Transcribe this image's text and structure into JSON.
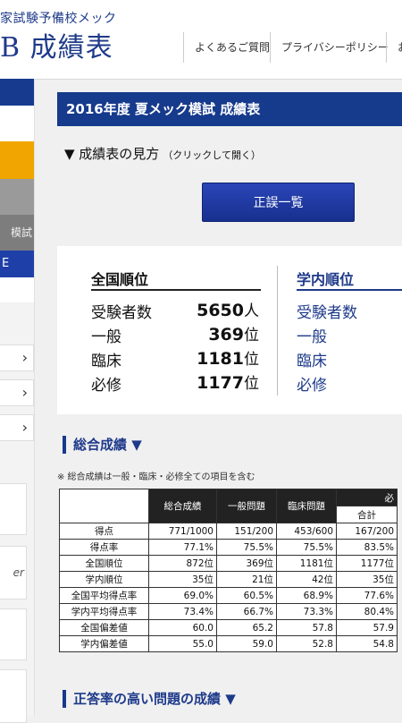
{
  "header": {
    "logo_sub": "家試験予備校メック",
    "logo_main": "B 成績表",
    "nav": [
      "よくあるご質問",
      "プライバシーポリシー",
      "お"
    ]
  },
  "sidebar": {
    "block_text": "模試",
    "block_label_e": "E"
  },
  "page": {
    "title": "2016年度 夏メック模試 成績表",
    "howto_label": "▼ 成績表の見方",
    "howto_hint": "（クリックして開く）",
    "errata_button": "正誤一覧"
  },
  "ranking": {
    "national_title": "全国順位",
    "school_title": "学内順位",
    "rows": [
      {
        "label": "受験者数",
        "value": "5650",
        "unit": "人"
      },
      {
        "label": "一般",
        "value": "369",
        "unit": "位"
      },
      {
        "label": "臨床",
        "value": "1181",
        "unit": "位"
      },
      {
        "label": "必修",
        "value": "1177",
        "unit": "位"
      }
    ],
    "school_rows": [
      "受験者数",
      "一般",
      "臨床",
      "必修"
    ]
  },
  "overall": {
    "section_title": "総合成績 ▼",
    "note": "※ 総合成績は一般・臨床・必修全ての項目を含む",
    "columns": [
      "総合成績",
      "一般問題",
      "臨床問題",
      "合計"
    ],
    "col_group_partial": "必",
    "rows": [
      {
        "label": "得点",
        "values": [
          "771/1000",
          "151/200",
          "453/600",
          "167/200"
        ]
      },
      {
        "label": "得点率",
        "values": [
          "77.1%",
          "75.5%",
          "75.5%",
          "83.5%"
        ]
      },
      {
        "label": "全国順位",
        "values": [
          "872位",
          "369位",
          "1181位",
          "1177位"
        ]
      },
      {
        "label": "学内順位",
        "values": [
          "35位",
          "21位",
          "42位",
          "35位"
        ]
      },
      {
        "label": "全国平均得点率",
        "values": [
          "69.0%",
          "60.5%",
          "68.9%",
          "77.6%"
        ]
      },
      {
        "label": "学内平均得点率",
        "values": [
          "73.4%",
          "66.7%",
          "73.3%",
          "80.4%"
        ]
      },
      {
        "label": "全国偏差値",
        "values": [
          "60.0",
          "65.2",
          "57.8",
          "57.9"
        ]
      },
      {
        "label": "学内偏差値",
        "values": [
          "55.0",
          "59.0",
          "52.8",
          "54.8"
        ]
      }
    ]
  },
  "high_accuracy": {
    "section_title": "正答率の高い問題の成績 ▼"
  },
  "colors": {
    "brand": "#163a8c",
    "sidebar_orange": "#f0a500",
    "sidebar_gray": "#8a8a8a"
  },
  "icons": [
    "chevron-right-icon",
    "triangle-down-icon"
  ]
}
